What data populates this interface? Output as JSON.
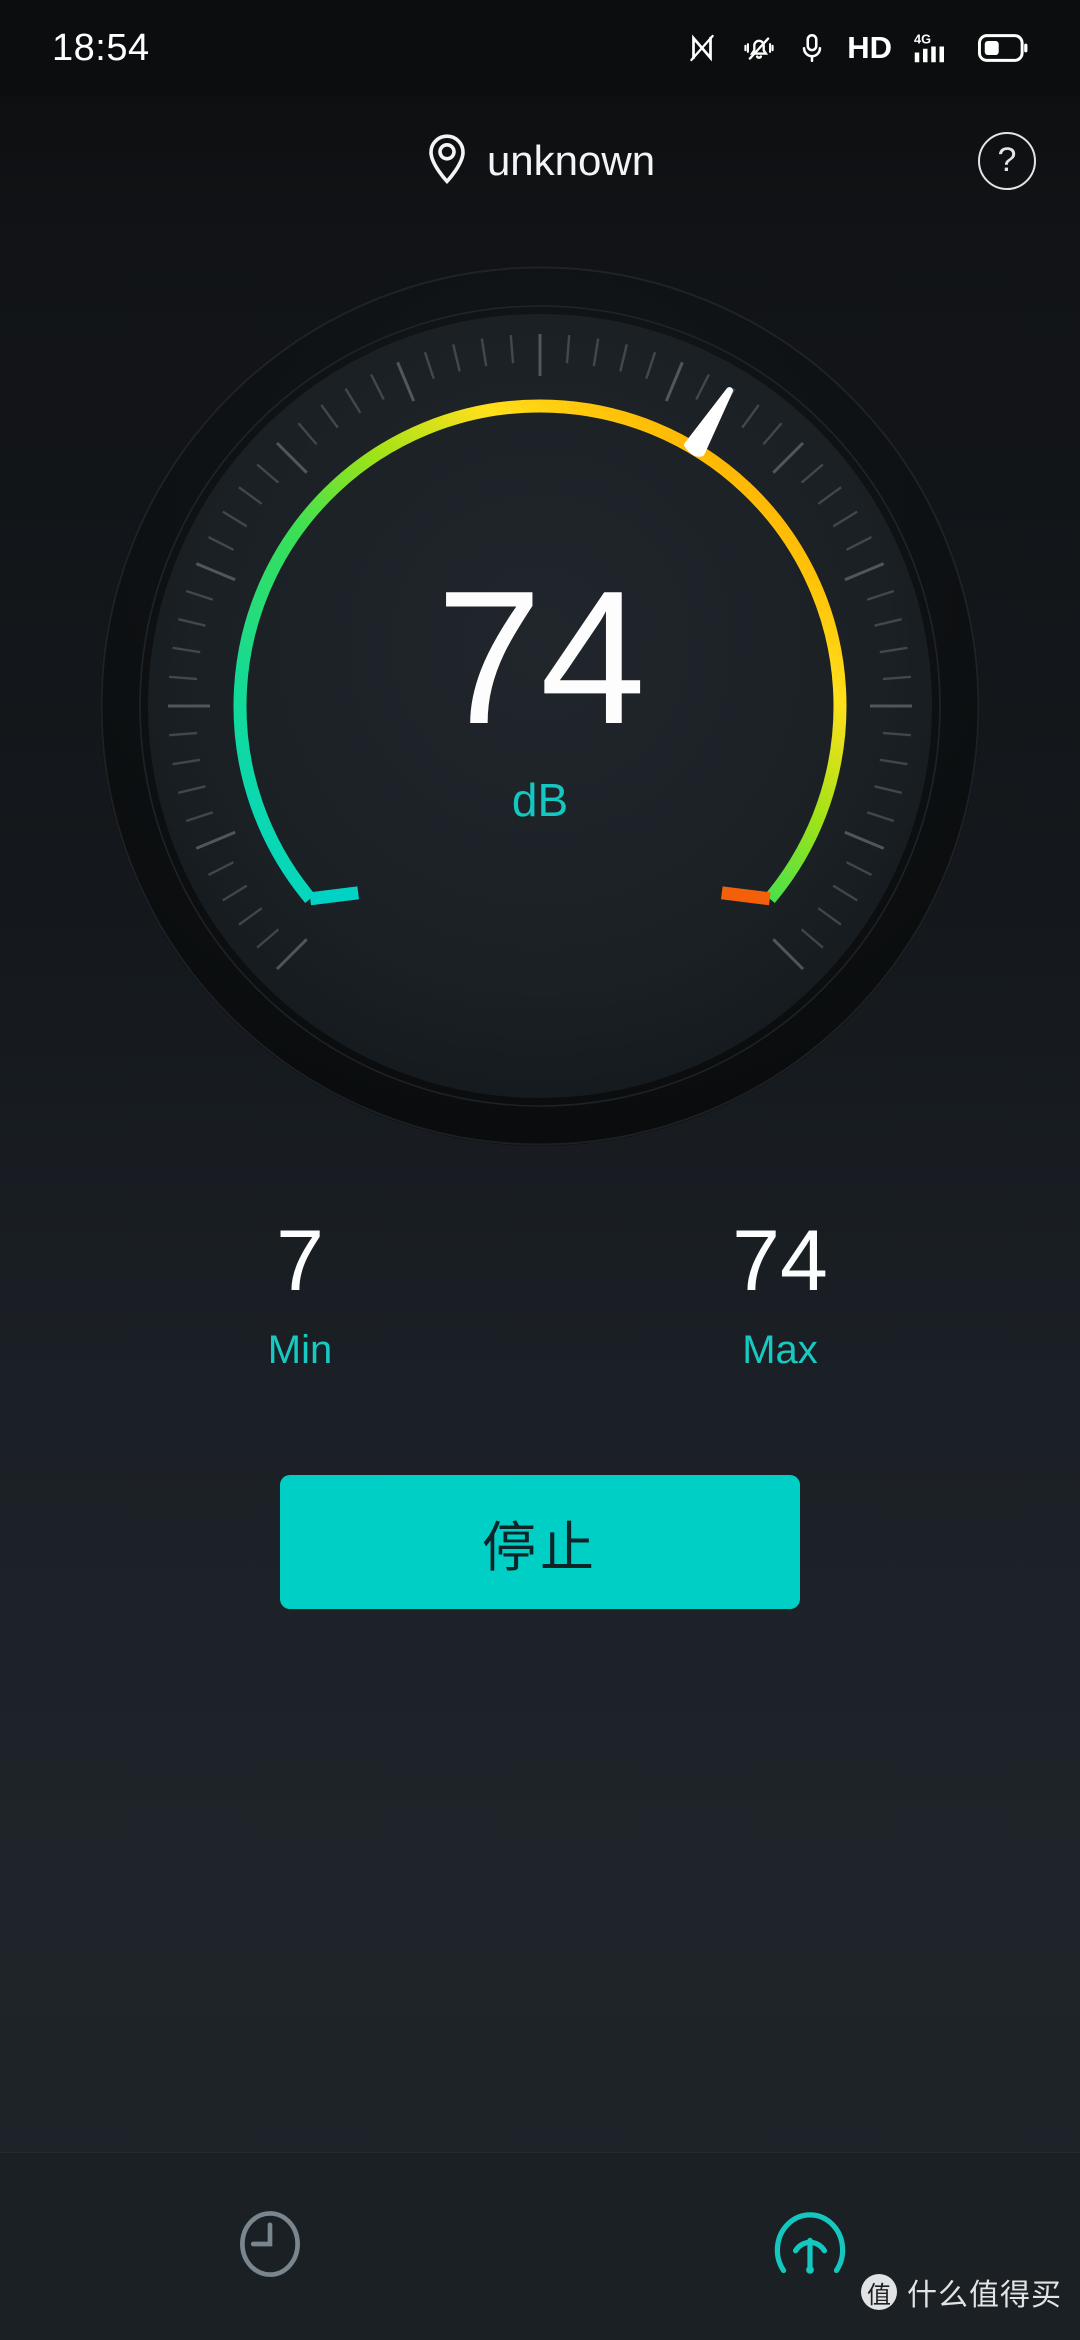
{
  "status_bar": {
    "time": "18:54",
    "icons": [
      "nfc-icon",
      "vibrate-off-icon",
      "microphone-icon",
      "hd-icon",
      "4g-signal-icon",
      "battery-icon"
    ],
    "hd_label": "HD",
    "network_label": "4G"
  },
  "header": {
    "location_icon": "location-pin-icon",
    "location_label": "unknown",
    "help_label": "?"
  },
  "gauge": {
    "value": "74",
    "unit": "dB",
    "needle_value": 74,
    "scale_min": 0,
    "scale_max": 120
  },
  "stats": {
    "min": {
      "value": "7",
      "label": "Min"
    },
    "max": {
      "value": "74",
      "label": "Max"
    }
  },
  "action": {
    "label": "停止"
  },
  "bottom_nav": {
    "items": [
      {
        "name": "history-tab",
        "icon": "clock-icon",
        "active": false
      },
      {
        "name": "meter-tab",
        "icon": "gauge-icon",
        "active": true
      }
    ]
  },
  "watermark": {
    "badge": "值",
    "text": "什么值得买"
  },
  "colors": {
    "background": "#1e2328",
    "accent": "#00cfc5",
    "accent_text": "#14c8c0",
    "value_text": "#fdfdfd",
    "arc_start": "#00d6c8",
    "arc_green": "#2ddf6e",
    "arc_yellow": "#ffe01b",
    "arc_end": "#f46a0a",
    "needle": "#ffffff",
    "tick": "#6f7a80",
    "nav_inactive": "#7a868e",
    "nav_active": "#14c8c0"
  },
  "chart_data": {
    "type": "gauge",
    "title": "Sound level meter",
    "value": 74,
    "unit": "dB",
    "min": 0,
    "max": 120,
    "min_reading": 7,
    "max_reading": 74,
    "arc_sweep_degrees": 270,
    "arc_start_angle_deg": 135,
    "gradient_stops": [
      "#00d6c8",
      "#2ddf6e",
      "#8fe21c",
      "#ffe01b",
      "#f46a0a"
    ],
    "tick_count": 61,
    "needle_angle_deg": 31
  }
}
